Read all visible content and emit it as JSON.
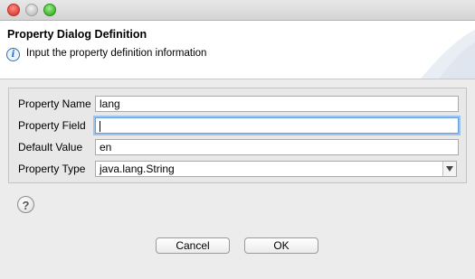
{
  "header": {
    "title": "Property Dialog Definition",
    "message": "Input the property definition information"
  },
  "form": {
    "property_name": {
      "label": "Property Name",
      "value": "lang"
    },
    "property_field": {
      "label": "Property Field",
      "value": ""
    },
    "default_value": {
      "label": "Default Value",
      "value": "en"
    },
    "property_type": {
      "label": "Property Type",
      "value": "java.lang.String"
    }
  },
  "buttons": {
    "cancel": "Cancel",
    "ok": "OK"
  },
  "icons": {
    "info": "info-icon",
    "help": "help-icon",
    "dropdown": "chevron-down-icon"
  },
  "colors": {
    "focus": "#9cc3f0",
    "info": "#2d6fb5"
  }
}
